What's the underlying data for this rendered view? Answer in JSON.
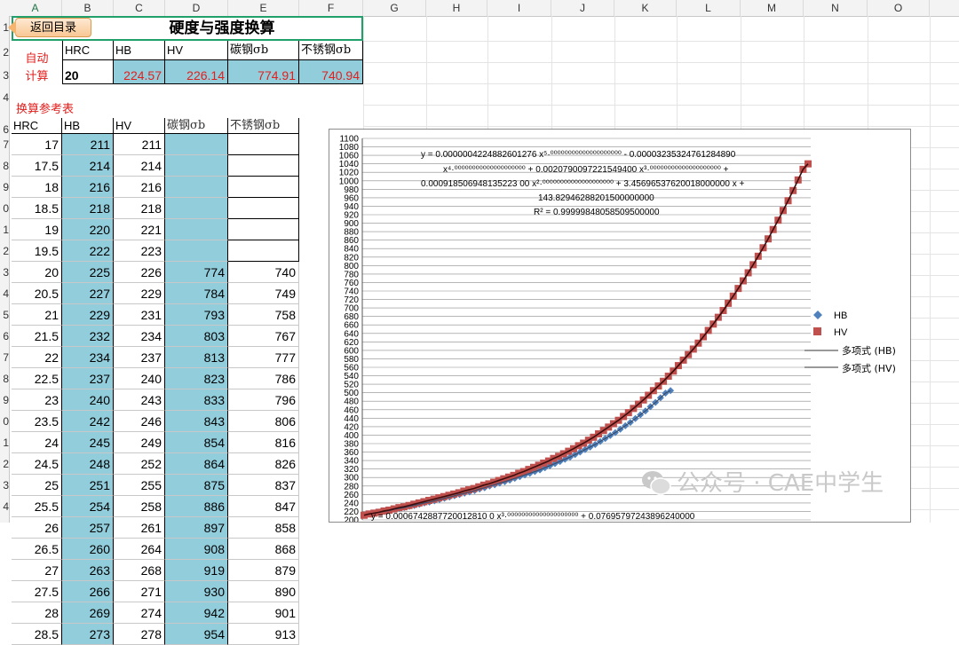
{
  "columns": [
    "A",
    "B",
    "C",
    "D",
    "E",
    "F",
    "G",
    "H",
    "I",
    "J",
    "K",
    "L",
    "M",
    "N",
    "O"
  ],
  "rows": [
    "1",
    "2",
    "3",
    "4",
    "5",
    "6",
    "7",
    "8",
    "9",
    "0",
    "1",
    "2",
    "3",
    "4",
    "5",
    "6",
    "7",
    "8",
    "9",
    "0",
    "1",
    "2",
    "3",
    "4",
    "5",
    "6",
    "7",
    "8",
    "9",
    "0"
  ],
  "header": {
    "back_button": "返回目录",
    "title": "硬度与强度换算"
  },
  "auto_calc": {
    "label_line1": "自动",
    "label_line2": "计算",
    "headers": [
      "HRC",
      "HB",
      "HV",
      "碳钢σb",
      "不锈钢σb"
    ],
    "values": [
      "20",
      "224.57",
      "226.14",
      "774.91",
      "740.94"
    ]
  },
  "ref_table": {
    "caption": "换算参考表",
    "headers": [
      "HRC",
      "HB",
      "HV",
      "碳钢σb",
      "不锈钢σb"
    ],
    "rows": [
      [
        "17",
        "211",
        "211",
        "",
        ""
      ],
      [
        "17.5",
        "214",
        "214",
        "",
        ""
      ],
      [
        "18",
        "216",
        "216",
        "",
        ""
      ],
      [
        "18.5",
        "218",
        "218",
        "",
        ""
      ],
      [
        "19",
        "220",
        "221",
        "",
        ""
      ],
      [
        "19.5",
        "222",
        "223",
        "",
        ""
      ],
      [
        "20",
        "225",
        "226",
        "774",
        "740"
      ],
      [
        "20.5",
        "227",
        "229",
        "784",
        "749"
      ],
      [
        "21",
        "229",
        "231",
        "793",
        "758"
      ],
      [
        "21.5",
        "232",
        "234",
        "803",
        "767"
      ],
      [
        "22",
        "234",
        "237",
        "813",
        "777"
      ],
      [
        "22.5",
        "237",
        "240",
        "823",
        "786"
      ],
      [
        "23",
        "240",
        "243",
        "833",
        "796"
      ],
      [
        "23.5",
        "242",
        "246",
        "843",
        "806"
      ],
      [
        "24",
        "245",
        "249",
        "854",
        "816"
      ],
      [
        "24.5",
        "248",
        "252",
        "864",
        "826"
      ],
      [
        "25",
        "251",
        "255",
        "875",
        "837"
      ],
      [
        "25.5",
        "254",
        "258",
        "886",
        "847"
      ],
      [
        "26",
        "257",
        "261",
        "897",
        "858"
      ],
      [
        "26.5",
        "260",
        "264",
        "908",
        "868"
      ],
      [
        "27",
        "263",
        "268",
        "919",
        "879"
      ],
      [
        "27.5",
        "266",
        "271",
        "930",
        "890"
      ],
      [
        "28",
        "269",
        "274",
        "942",
        "901"
      ],
      [
        "28.5",
        "273",
        "278",
        "954",
        "913"
      ]
    ]
  },
  "chart_data": {
    "type": "scatter",
    "ylim": [
      200,
      1100
    ],
    "yticks": [
      "1100",
      "1080",
      "1060",
      "1040",
      "1020",
      "1000",
      "980",
      "960",
      "940",
      "920",
      "900",
      "880",
      "860",
      "840",
      "820",
      "800",
      "780",
      "760",
      "740",
      "720",
      "700",
      "680",
      "660",
      "640",
      "620",
      "600",
      "580",
      "560",
      "540",
      "520",
      "500",
      "480",
      "460",
      "440",
      "420",
      "400",
      "380",
      "360",
      "340",
      "320",
      "300",
      "280",
      "260",
      "240",
      "220",
      "200"
    ],
    "equation_lines": [
      "y = 0.0000004224882601276 x⁵·⁰⁰⁰⁰⁰⁰⁰⁰⁰⁰⁰⁰⁰⁰⁰⁰⁰⁰⁰⁰ - 0.00003235324761284890",
      "x⁴·⁰⁰⁰⁰⁰⁰⁰⁰⁰⁰⁰⁰⁰⁰⁰⁰⁰⁰⁰⁰ + 0.0020790097221549400 x³·⁰⁰⁰⁰⁰⁰⁰⁰⁰⁰⁰⁰⁰⁰⁰⁰⁰⁰⁰⁰ +",
      "0.000918506948135223 00 x²·⁰⁰⁰⁰⁰⁰⁰⁰⁰⁰⁰⁰⁰⁰⁰⁰⁰⁰⁰⁰ + 3.45696537620018000000 x +",
      "143.82946288201500000000",
      "R² = 0.99999848058509500000"
    ],
    "equation_bottom": "y = 0.0006742887720012810 0 x³·⁰⁰⁰⁰⁰⁰⁰⁰⁰⁰⁰⁰⁰⁰⁰⁰⁰⁰⁰⁰ + 0.07695797243896240000",
    "series": [
      {
        "name": "HB",
        "marker": "diamond",
        "color": "#4f81bd",
        "values": [
          211,
          214,
          216,
          218,
          220,
          222,
          225,
          227,
          229,
          232,
          234,
          237,
          240,
          242,
          245,
          248,
          251,
          254,
          257,
          260,
          263,
          266,
          269,
          273,
          276,
          280,
          283,
          287,
          290,
          294,
          298,
          302,
          306,
          310,
          314,
          318,
          323,
          328,
          333,
          338,
          343,
          348,
          354,
          360,
          366,
          372,
          378,
          385,
          392,
          399,
          406,
          414,
          422,
          430,
          439,
          448,
          457,
          467,
          477,
          488,
          499,
          505
        ]
      },
      {
        "name": "HV",
        "marker": "square",
        "color": "#c0504d",
        "values": [
          211,
          214,
          216,
          218,
          221,
          223,
          226,
          229,
          231,
          234,
          237,
          240,
          243,
          246,
          249,
          252,
          255,
          258,
          261,
          264,
          268,
          271,
          274,
          278,
          282,
          285,
          289,
          293,
          297,
          301,
          305,
          310,
          314,
          319,
          324,
          329,
          334,
          339,
          345,
          350,
          356,
          362,
          368,
          375,
          381,
          388,
          395,
          403,
          411,
          419,
          427,
          435,
          444,
          453,
          463,
          473,
          483,
          494,
          505,
          516,
          527,
          539,
          551,
          564,
          577,
          590,
          603,
          617,
          632,
          647,
          662,
          678,
          694,
          711,
          728,
          746,
          764,
          783,
          802,
          822,
          842,
          863,
          885,
          907,
          930,
          953,
          977,
          1002,
          1027,
          1040
        ]
      },
      {
        "name": "多项式 (HB)",
        "style": "line"
      },
      {
        "name": "多项式 (HV)",
        "style": "line"
      }
    ]
  },
  "watermark": "公众号 · CAE中学生",
  "colors": {
    "accent_green": "#22a06b",
    "cell_blue": "#92cddc",
    "text_red": "#e1201d",
    "hb_blue": "#4f81bd",
    "hv_red": "#c0504d",
    "trend_dark": "#3b0d0d"
  }
}
